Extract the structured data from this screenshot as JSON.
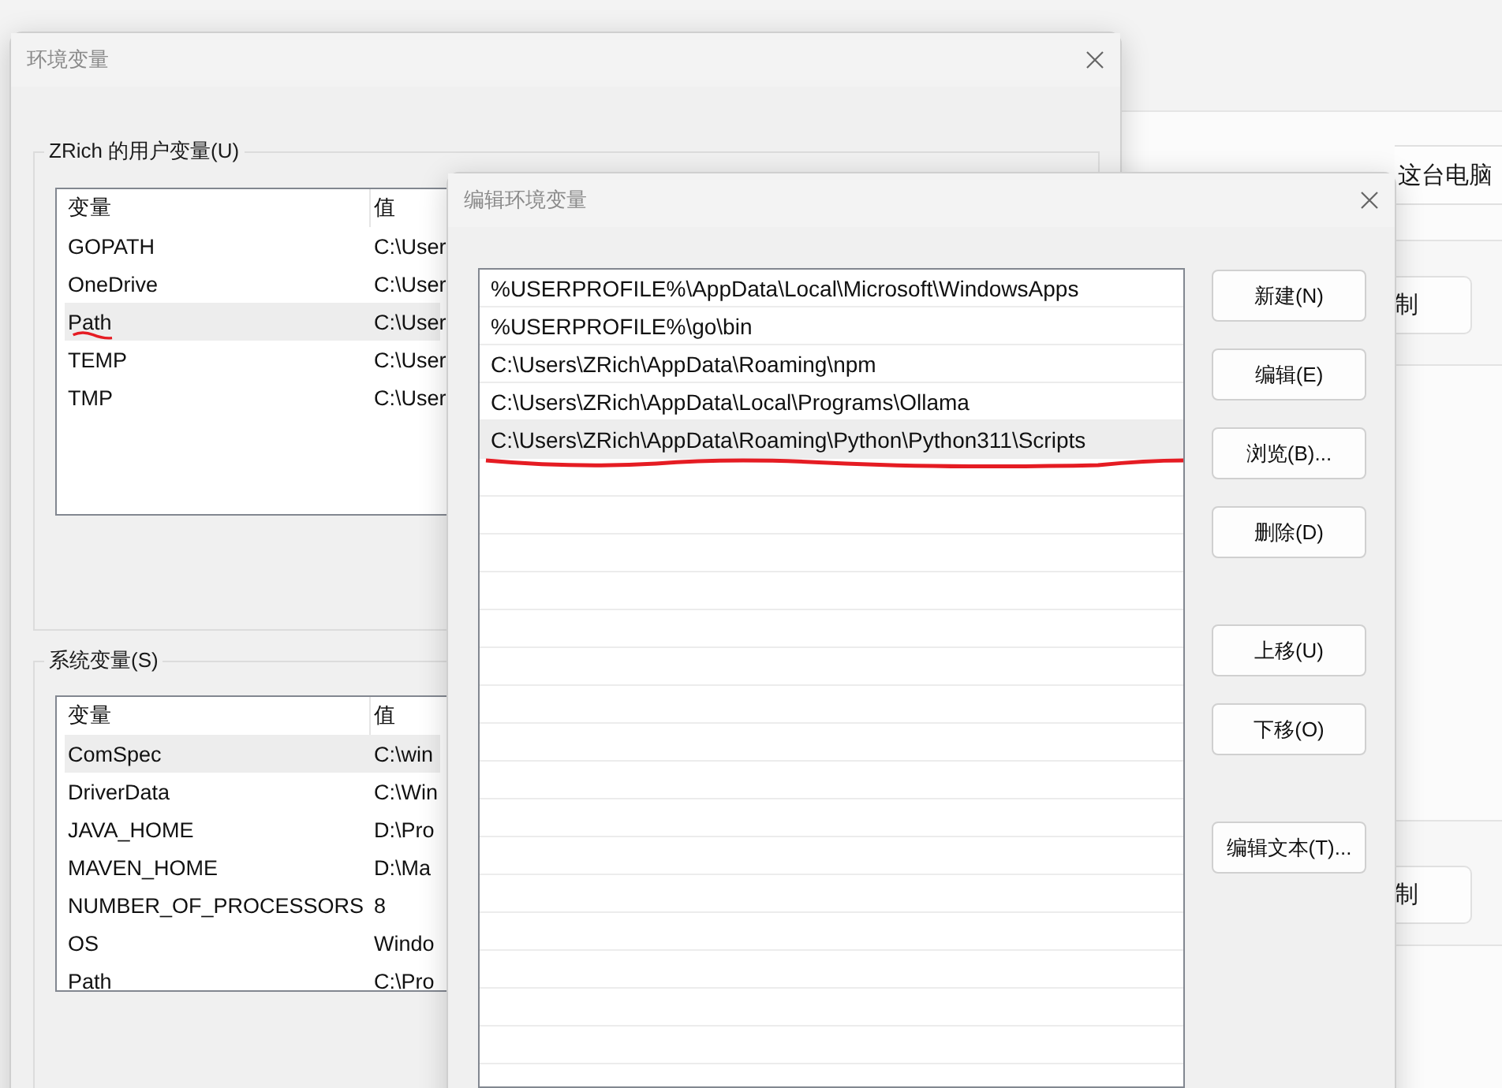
{
  "background": {
    "rename_button": "这台电脑",
    "buttons": [
      "制",
      "制"
    ]
  },
  "env_window": {
    "title": "环境变量",
    "user_group": {
      "label": "ZRich 的用户变量(U)",
      "columns": [
        "变量",
        "值"
      ],
      "rows": [
        {
          "name": "GOPATH",
          "value": "C:\\User",
          "selected": false,
          "underlined": false
        },
        {
          "name": "OneDrive",
          "value": "C:\\User",
          "selected": false,
          "underlined": false
        },
        {
          "name": "Path",
          "value": "C:\\User",
          "selected": true,
          "underlined": true
        },
        {
          "name": "TEMP",
          "value": "C:\\User",
          "selected": false,
          "underlined": false
        },
        {
          "name": "TMP",
          "value": "C:\\User",
          "selected": false,
          "underlined": false
        }
      ]
    },
    "system_group": {
      "label": "系统变量(S)",
      "columns": [
        "变量",
        "值"
      ],
      "rows": [
        {
          "name": "ComSpec",
          "value": "C:\\win",
          "selected": true,
          "underlined": false
        },
        {
          "name": "DriverData",
          "value": "C:\\Win",
          "selected": false,
          "underlined": false
        },
        {
          "name": "JAVA_HOME",
          "value": "D:\\Pro",
          "selected": false,
          "underlined": false
        },
        {
          "name": "MAVEN_HOME",
          "value": "D:\\Ma",
          "selected": false,
          "underlined": false
        },
        {
          "name": "NUMBER_OF_PROCESSORS",
          "value": "8",
          "selected": false,
          "underlined": false
        },
        {
          "name": "OS",
          "value": "Windo",
          "selected": false,
          "underlined": false
        },
        {
          "name": "Path",
          "value": "C:\\Pro",
          "selected": false,
          "underlined": false
        }
      ]
    }
  },
  "edit_window": {
    "title": "编辑环境变量",
    "entries": [
      {
        "text": "%USERPROFILE%\\AppData\\Local\\Microsoft\\WindowsApps",
        "selected": false,
        "underlined": false
      },
      {
        "text": "%USERPROFILE%\\go\\bin",
        "selected": false,
        "underlined": false
      },
      {
        "text": "C:\\Users\\ZRich\\AppData\\Roaming\\npm",
        "selected": false,
        "underlined": false
      },
      {
        "text": "C:\\Users\\ZRich\\AppData\\Local\\Programs\\Ollama",
        "selected": false,
        "underlined": false
      },
      {
        "text": "C:\\Users\\ZRich\\AppData\\Roaming\\Python\\Python311\\Scripts",
        "selected": true,
        "underlined": true
      }
    ],
    "button_groups": [
      [
        "新建(N)",
        "编辑(E)",
        "浏览(B)...",
        "删除(D)"
      ],
      [
        "上移(U)",
        "下移(O)"
      ],
      [
        "编辑文本(T)..."
      ]
    ]
  }
}
